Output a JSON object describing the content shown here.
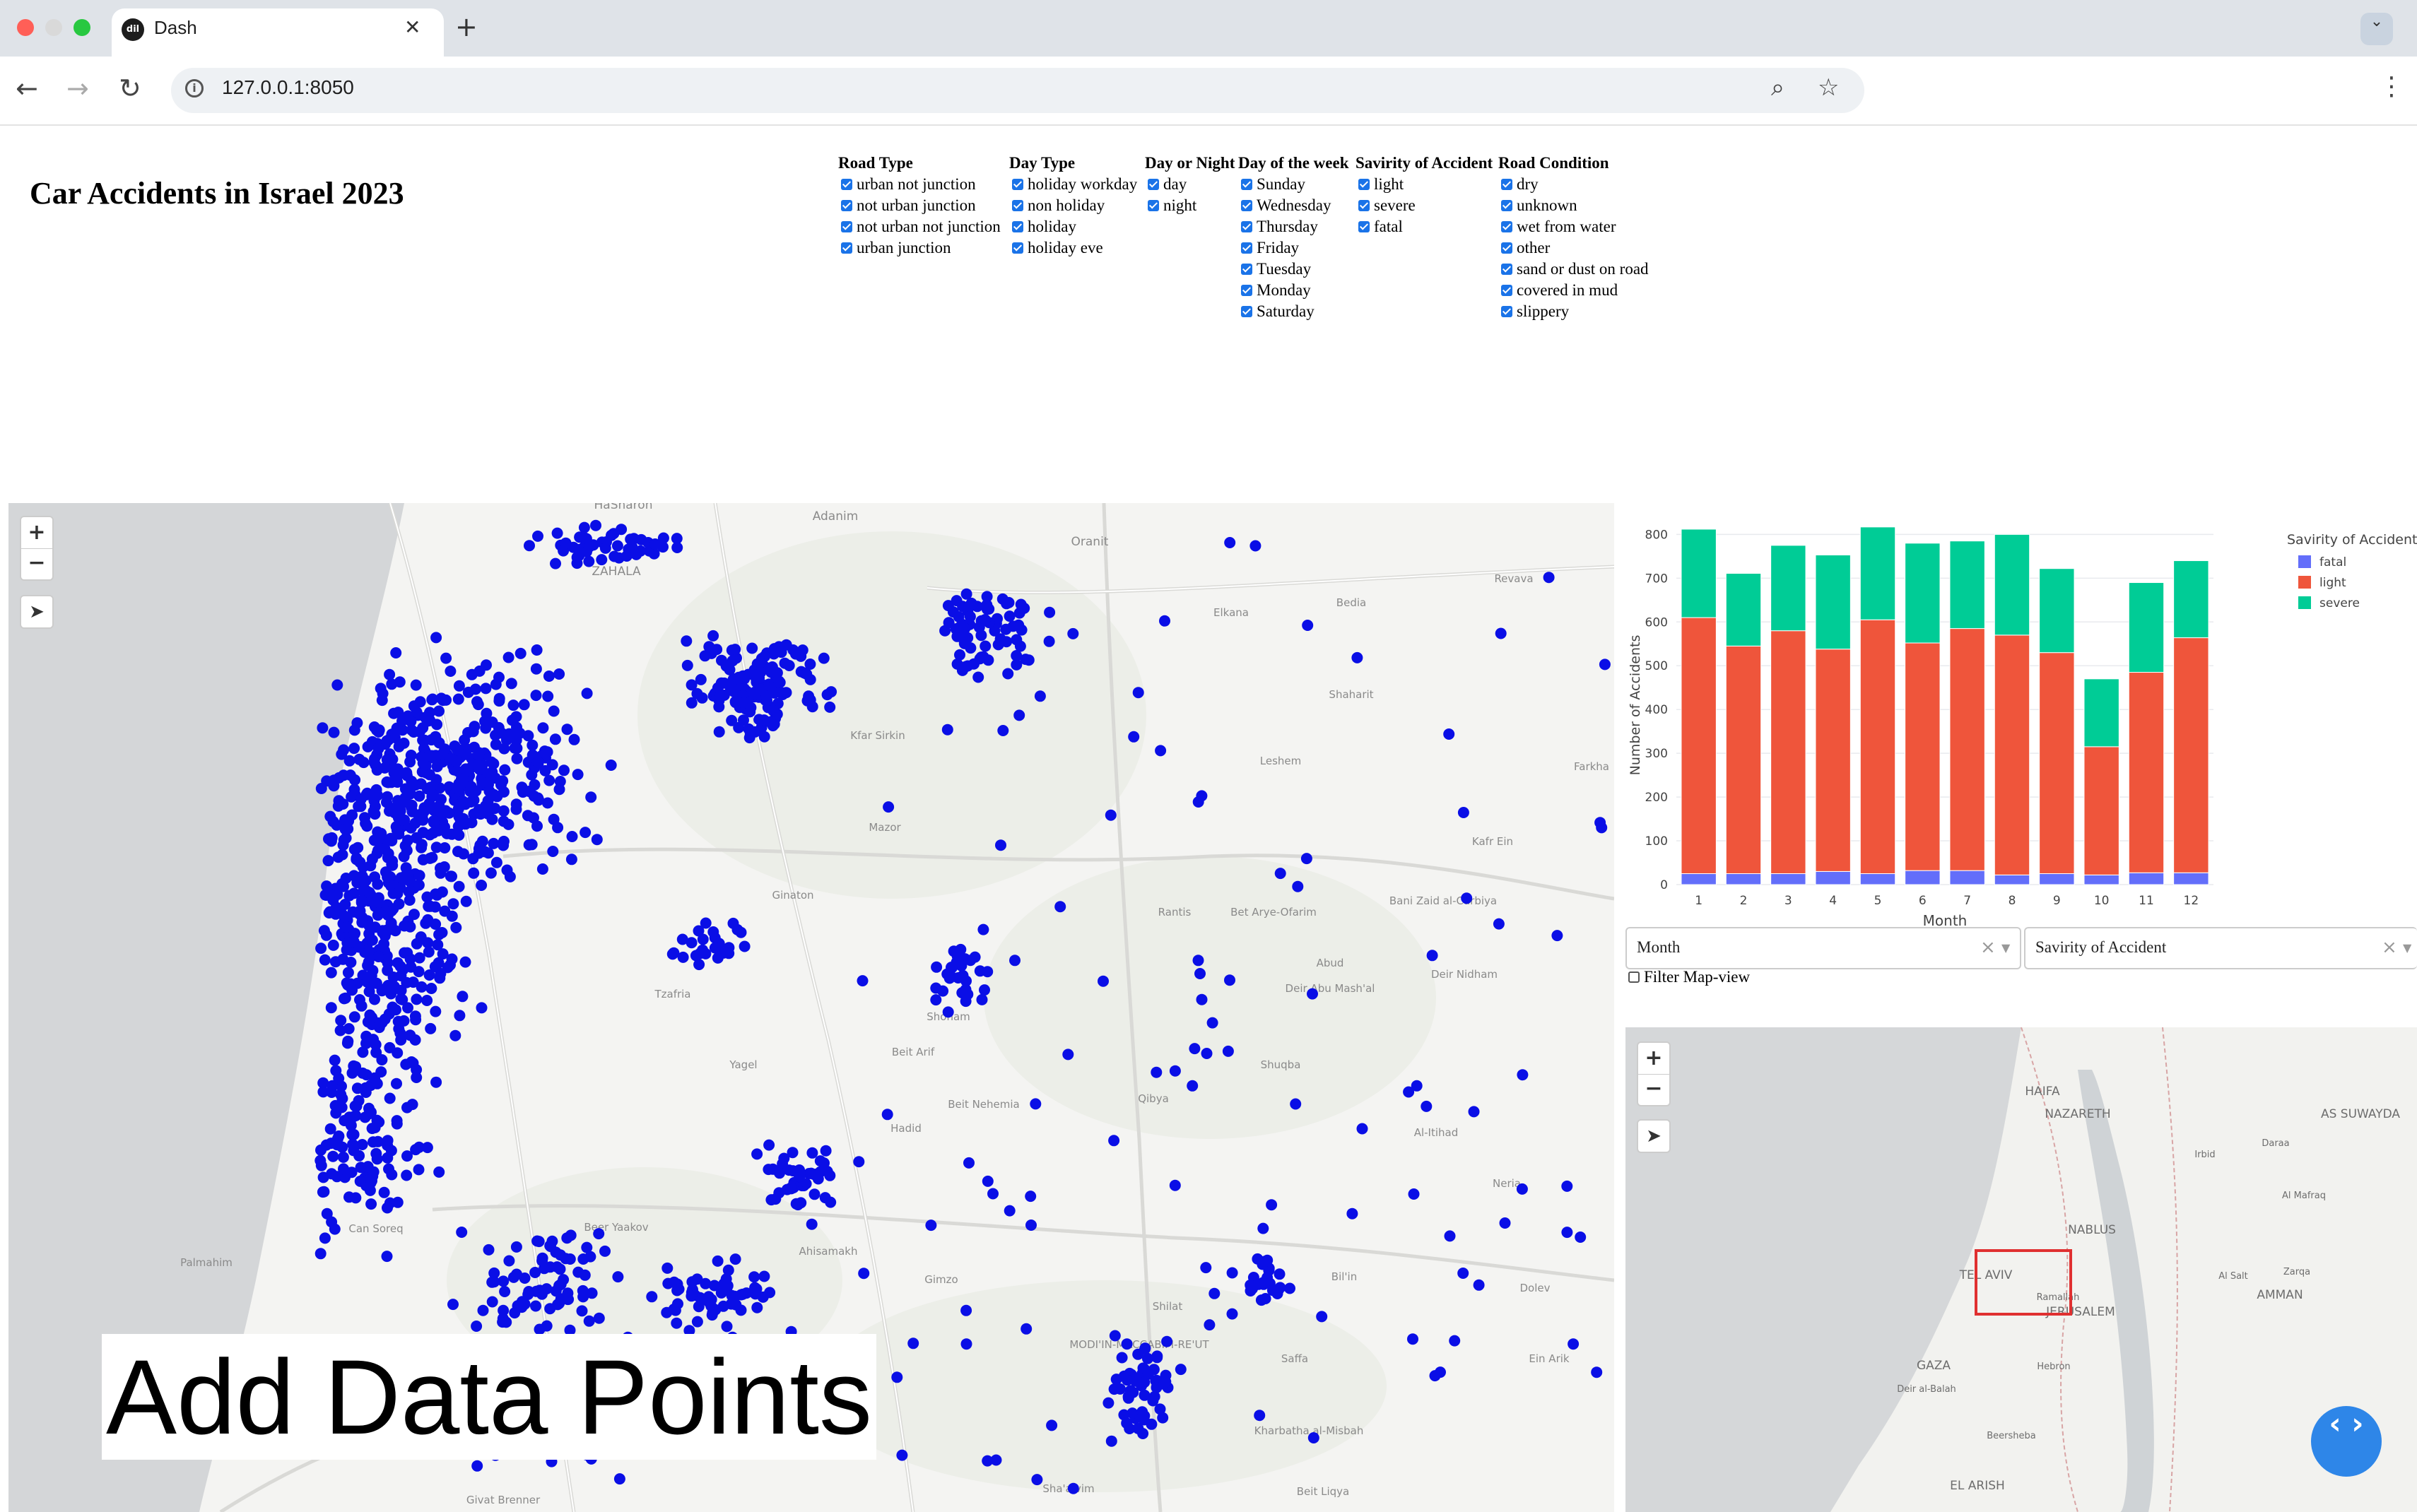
{
  "browser": {
    "tab_title": "Dash",
    "tab_favicon": "dash",
    "url": "127.0.0.1:8050"
  },
  "page_title": "Car Accidents in Israel 2023",
  "filters": [
    {
      "title": "Road Type",
      "options": [
        "urban not junction",
        "not urban junction",
        "not urban not junction",
        "urban junction"
      ]
    },
    {
      "title": "Day Type",
      "options": [
        "holiday workday",
        "non holiday",
        "holiday",
        "holiday eve"
      ]
    },
    {
      "title": "Day or Night",
      "options": [
        "day",
        "night"
      ]
    },
    {
      "title": "Day of the week",
      "options": [
        "Sunday",
        "Wednesday",
        "Thursday",
        "Friday",
        "Tuesday",
        "Monday",
        "Saturday"
      ]
    },
    {
      "title": "Savirity of Accident",
      "options": [
        "light",
        "severe",
        "fatal"
      ]
    },
    {
      "title": "Road Condition",
      "options": [
        "dry",
        "unknown",
        "wet from water",
        "other",
        "sand or dust on road",
        "covered in mud",
        "slippery"
      ]
    }
  ],
  "map": {
    "zoom_in": "+",
    "zoom_out": "−",
    "place_labels": [
      {
        "name": "HaSharon"
      },
      {
        "name": "Adanim"
      },
      {
        "name": "ZAHALA"
      },
      {
        "name": "Oranit"
      },
      {
        "name": "Bedia"
      },
      {
        "name": "Revava"
      },
      {
        "name": "Elkana"
      },
      {
        "name": "Shaharit"
      },
      {
        "name": "Leshem"
      },
      {
        "name": "Farkha"
      },
      {
        "name": "Kafr Ein"
      },
      {
        "name": "Mazor"
      },
      {
        "name": "Rantis"
      },
      {
        "name": "Bet Arye-Ofarim"
      },
      {
        "name": "Bani Zaid al-Carbiya"
      },
      {
        "name": "Abud"
      },
      {
        "name": "Deir Nidham"
      },
      {
        "name": "Deir Abu Mash'al"
      },
      {
        "name": "Shuqba"
      },
      {
        "name": "Qibya"
      },
      {
        "name": "Al-Itihad"
      },
      {
        "name": "Neria"
      },
      {
        "name": "Tzafria"
      },
      {
        "name": "Beit Arif"
      },
      {
        "name": "Hadid"
      },
      {
        "name": "Beer Yaakov"
      },
      {
        "name": "Can Soreq"
      },
      {
        "name": "Palmahim"
      },
      {
        "name": "Ahisamakh"
      },
      {
        "name": "Gimzo"
      },
      {
        "name": "Bil'in"
      },
      {
        "name": "Dolev"
      },
      {
        "name": "Shilat"
      },
      {
        "name": "MODI'IN-MACCABIM-RE'UT"
      },
      {
        "name": "Saffa"
      },
      {
        "name": "Ein Arik"
      },
      {
        "name": "Kharbatha al-Misbah"
      },
      {
        "name": "Sha'alvim"
      },
      {
        "name": "Beit Liqya"
      },
      {
        "name": "Givat Brenner"
      },
      {
        "name": "Beit Nehemia"
      },
      {
        "name": "Shoham"
      },
      {
        "name": "Kfar Sirkin"
      },
      {
        "name": "Yagel"
      },
      {
        "name": "Ginaton"
      }
    ]
  },
  "overlay_text": "Add Data Points",
  "chart_data": {
    "type": "bar",
    "stacked": true,
    "xlabel": "Month",
    "ylabel": "Number of Accidents",
    "ylim": [
      0,
      820
    ],
    "yticks": [
      0,
      100,
      200,
      300,
      400,
      500,
      600,
      700,
      800
    ],
    "categories": [
      "1",
      "2",
      "3",
      "4",
      "5",
      "6",
      "7",
      "8",
      "9",
      "10",
      "11",
      "12"
    ],
    "legend_title": "Savirity of Accident",
    "legend_position": "top-right",
    "series": [
      {
        "name": "fatal",
        "color": "#636efa",
        "values": [
          25,
          25,
          25,
          30,
          25,
          32,
          32,
          22,
          25,
          22,
          27,
          27
        ]
      },
      {
        "name": "light",
        "color": "#ef553b",
        "values": [
          585,
          520,
          555,
          508,
          580,
          520,
          553,
          548,
          505,
          293,
          458,
          537
        ]
      },
      {
        "name": "severe",
        "color": "#00cc96",
        "values": [
          202,
          166,
          195,
          215,
          212,
          228,
          200,
          230,
          192,
          155,
          205,
          176
        ]
      }
    ]
  },
  "controls": {
    "x_dropdown": "Month",
    "color_dropdown": "Savirity of Accident",
    "filter_map_view": "Filter Map-view",
    "filter_map_view_checked": false
  },
  "minimap": {
    "labels": [
      {
        "name": "HAIFA"
      },
      {
        "name": "NAZARETH"
      },
      {
        "name": "AS SUWAYDA"
      },
      {
        "name": "Irbid"
      },
      {
        "name": "Daraa"
      },
      {
        "name": "Al Mafraq"
      },
      {
        "name": "NABLUS"
      },
      {
        "name": "Al Salt"
      },
      {
        "name": "Zarqa"
      },
      {
        "name": "TEL AVIV"
      },
      {
        "name": "AMMAN"
      },
      {
        "name": "Ramallah"
      },
      {
        "name": "JERUSALEM"
      },
      {
        "name": "GAZA"
      },
      {
        "name": "Hebron"
      },
      {
        "name": "Deir al-Balah"
      },
      {
        "name": "Beersheba"
      },
      {
        "name": "EL ARISH"
      }
    ]
  },
  "fab_icon": "code-icon"
}
